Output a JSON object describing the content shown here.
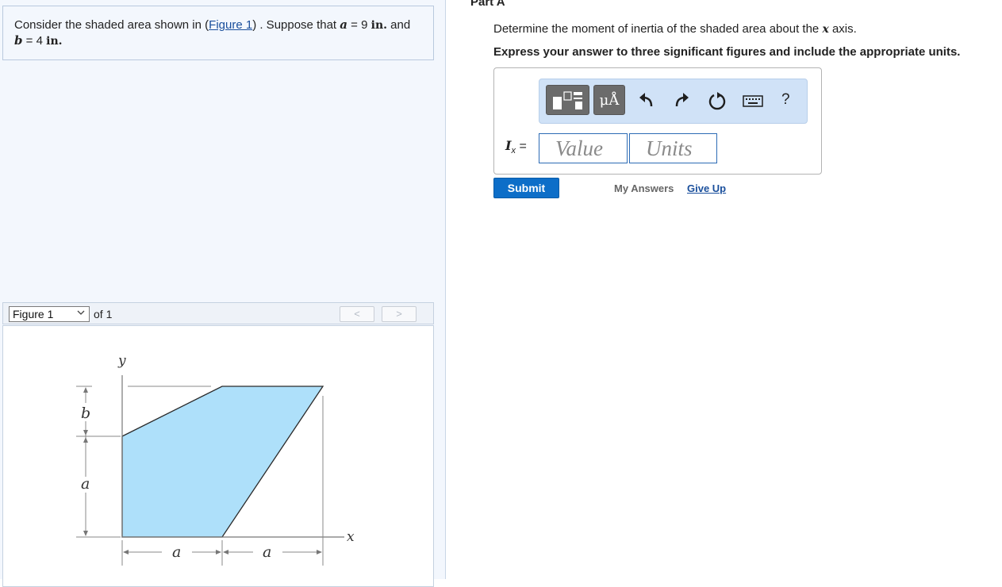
{
  "problem": {
    "text_before_link": "Consider the shaded area shown in (",
    "link_label": "Figure 1",
    "text_after_link": ") . Suppose that",
    "var_a": "a",
    "eq_a": "= 9",
    "unit_a": "in.",
    "and": "and",
    "var_b": "b",
    "eq_b": "= 4",
    "unit_b": "in."
  },
  "figure_nav": {
    "selected": "Figure 1",
    "of_label": "of 1",
    "prev_label": "<",
    "next_label": ">"
  },
  "figure": {
    "label_y": "y",
    "label_x": "x",
    "label_b": "b",
    "label_a_vertical": "a",
    "label_a_left": "a",
    "label_a_right": "a",
    "fill_color": "#aee0fa"
  },
  "part": {
    "title": "Part A",
    "question_before": "Determine the moment of inertia of the shaded area about the",
    "question_var": "x",
    "question_after": "axis.",
    "instruction": "Express your answer to three significant figures and include the appropriate units."
  },
  "toolbar": {
    "units_button": "μÅ",
    "undo_icon": "undo-icon",
    "redo_icon": "redo-icon",
    "reset_icon": "reset-icon",
    "keyboard_icon": "keyboard-icon",
    "help": "?"
  },
  "answer": {
    "var": "I",
    "sub": "x",
    "eq": "=",
    "value_placeholder": "Value",
    "units_placeholder": "Units"
  },
  "actions": {
    "submit": "Submit",
    "my_answers": "My Answers",
    "give_up": "Give Up"
  },
  "colors": {
    "accent": "#0d6ec8",
    "toolbar_bg": "#d0e2f7",
    "left_bg": "#f3f7fd"
  }
}
